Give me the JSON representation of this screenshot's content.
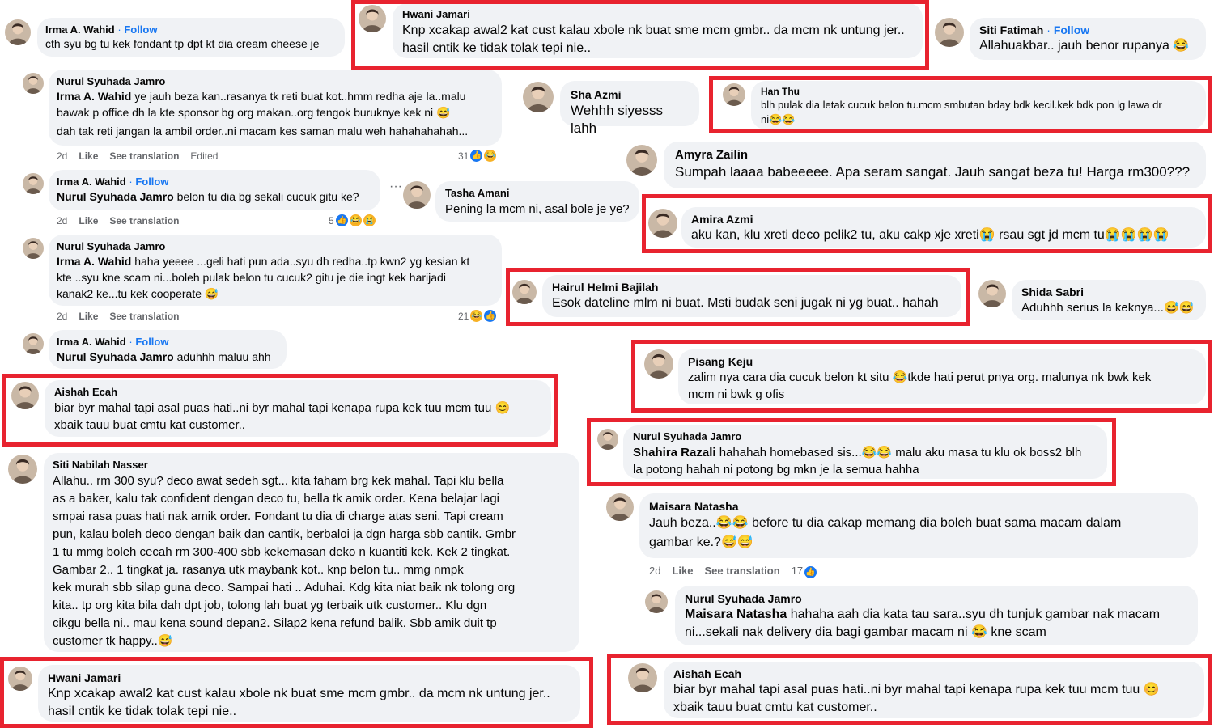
{
  "colors": {
    "highlight": "#e8232f",
    "bubble": "#f0f2f5",
    "link": "#1877f2",
    "meta": "#65676b"
  },
  "c1": {
    "name": "Irma A. Wahid",
    "follow": "Follow",
    "text": "cth syu bg tu kek fondant tp dpt kt dia cream cheese je"
  },
  "c2": {
    "name": "Hwani Jamari",
    "line1": "Knp xcakap awal2 kat cust kalau xbole nk buat sme mcm gmbr.. da mcm nk untung jer..",
    "line2": "hasil cntik ke tidak tolak tepi nie.."
  },
  "c3": {
    "name": "Siti Fatimah",
    "follow": "Follow",
    "text": "Allahuakbar.. jauh benor rupanya"
  },
  "c4": {
    "name": "Nurul Syuhada Jamro",
    "mention": "Irma A. Wahid",
    "line1": " ye jauh beza kan..rasanya tk reti buat kot..hmm redha aje la..malu",
    "line2": "bawak p office dh la kte sponsor bg org makan..org tengok buruknye kek ni",
    "line3": "dah tak reti jangan la ambil order..ni macam kes saman malu weh hahahahahah...",
    "time": "2d",
    "like": "Like",
    "translate": "See translation",
    "edited": "Edited",
    "reactions": "31"
  },
  "c5": {
    "name": "Sha Azmi",
    "text": "Wehhh siyesss lahh"
  },
  "c6": {
    "name": "Han Thu",
    "line1": "blh pulak dia letak cucuk belon tu.mcm smbutan bday bdk kecil.kek bdk pon lg lawa dr",
    "line2": "ni"
  },
  "c7": {
    "name": "Amyra Zailin",
    "text": "Sumpah laaaa babeeeee. Apa seram sangat. Jauh sangat beza tu! Harga rm300???"
  },
  "c8": {
    "name": "Irma A. Wahid",
    "follow": "Follow",
    "mention": "Nurul Syuhada Jamro",
    "text": " belon tu dia bg sekali cucuk gitu ke?",
    "time": "2d",
    "like": "Like",
    "translate": "See translation",
    "reactions": "5"
  },
  "c9": {
    "name": "Tasha Amani",
    "text": "Pening la mcm ni, asal bole je ye?"
  },
  "c10": {
    "name": "Amira Azmi",
    "text1": "aku kan, klu xreti deco pelik2 tu, aku cakp xje xreti",
    "text2": " rsau sgt jd mcm tu"
  },
  "c11": {
    "name": "Nurul Syuhada Jamro",
    "mention": "Irma A. Wahid",
    "line1": " haha yeeee ...geli hati pun ada..syu dh redha..tp kwn2 yg kesian kt",
    "line2": "kte ..syu kne scam ni...boleh pulak belon tu cucuk2 gitu je die ingt kek harijadi",
    "line3": "kanak2 ke...tu kek cooperate",
    "time": "2d",
    "like": "Like",
    "translate": "See translation",
    "reactions": "21"
  },
  "c12": {
    "name": "Hairul Helmi Bajilah",
    "text": "Esok dateline mlm ni buat. Msti budak seni jugak ni yg buat.. hahah"
  },
  "c13": {
    "name": "Shida Sabri",
    "text": "Aduhhh serius la keknya..."
  },
  "c14": {
    "name": "Irma A. Wahid",
    "follow": "Follow",
    "mention": "Nurul Syuhada Jamro",
    "text": " aduhhh maluu ahh"
  },
  "c15": {
    "name": "Pisang Keju",
    "line1a": "zalim nya cara dia cucuk belon kt situ ",
    "line1b": "tkde hati perut pnya org. malunya nk bwk kek",
    "line2": "mcm ni bwk g ofis"
  },
  "c16": {
    "name": "Aishah Ecah",
    "line1": "biar byr mahal tapi asal puas hati..ni byr mahal tapi kenapa rupa kek tuu mcm tuu",
    "line2": "xbaik tauu buat cmtu kat customer.."
  },
  "c17": {
    "name": "Nurul Syuhada Jamro",
    "mention": "Shahira Razali",
    "line1a": " hahahah homebased sis...",
    "line1b": " malu aku masa tu klu ok boss2 blh",
    "line2": "la potong hahah ni potong bg mkn je la semua hahha"
  },
  "c18": {
    "name": "Siti Nabilah Nasser",
    "lines": [
      "Allahu.. rm 300 syu? deco awat sedeh sgt...  kita faham brg kek mahal. Tapi klu bella",
      "as a baker, kalu tak confident dengan deco tu, bella tk amik order. Kena belajar lagi",
      "smpai rasa puas hati nak amik order. Fondant tu dia di charge atas seni. Tapi cream",
      "pun, kalau boleh deco dengan baik dan cantik, berbaloi ja dgn harga sbb cantik. Gmbr",
      "1 tu mmg boleh cecah rm 300-400 sbb kekemasan deko n kuantiti kek. Kek 2 tingkat.",
      "Gambar 2.. 1 tingkat ja. rasanya utk maybank kot.. knp belon tu..   mmg nmpk",
      "kek murah sbb silap guna deco. Sampai hati .. Aduhai. Kdg kita niat baik nk tolong org",
      "kita.. tp org kita bila dah dpt job, tolong lah buat yg terbaik utk customer.. Klu dgn",
      "cikgu bella ni.. mau kena sound depan2. Silap2 kena refund balik. Sbb amik duit tp",
      "customer tk happy.."
    ]
  },
  "c19": {
    "name": "Maisara Natasha",
    "line1a": "Jauh beza..",
    "line1b": " before tu dia cakap memang dia boleh buat sama macam dalam",
    "line2": "gambar ke.?",
    "time": "2d",
    "like": "Like",
    "translate": "See translation",
    "reactions": "17"
  },
  "c20": {
    "name": "Nurul Syuhada Jamro",
    "mention": "Maisara Natasha",
    "line1": " hahaha aah dia kata tau sara..syu dh tunjuk gambar nak macam",
    "line2a": "ni...sekali nak delivery dia bagi gambar macam ni ",
    "line2b": " kne scam"
  },
  "c21": {
    "name": "Hwani Jamari",
    "line1": "Knp xcakap awal2 kat cust kalau xbole nk buat sme mcm gmbr.. da mcm nk untung jer..",
    "line2": "hasil cntik ke tidak tolak tepi nie.."
  },
  "c22": {
    "name": "Aishah Ecah",
    "line1": "biar byr mahal tapi asal puas hati..ni byr mahal tapi kenapa rupa kek tuu mcm tuu",
    "line2": "xbaik tauu buat cmtu kat customer.."
  },
  "emoji": {
    "laugh": "😂",
    "sweat": "😅",
    "cry": "😭",
    "sad": "😥",
    "fear": "😨",
    "smile": "😊",
    "like": "👍"
  }
}
